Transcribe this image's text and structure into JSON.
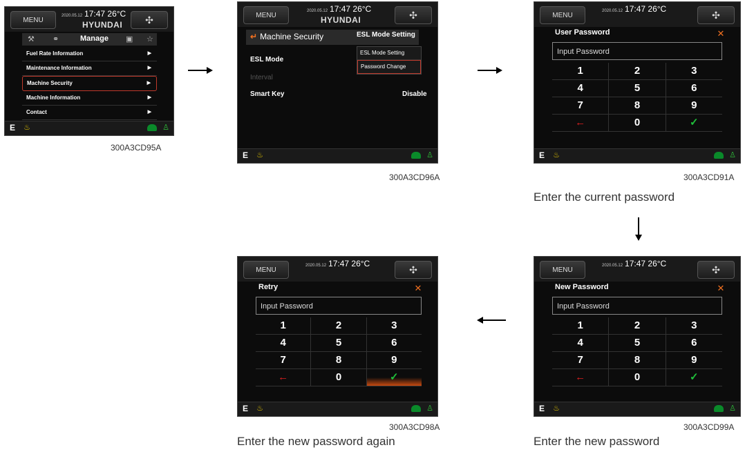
{
  "common": {
    "menu": "MENU",
    "date": "2020.05.12",
    "time": "17:47",
    "temp": "26°C",
    "brand": "HYUNDAI",
    "mode": "E"
  },
  "screen1": {
    "tab_active": "Manage",
    "items": [
      {
        "label": "Fuel Rate Information"
      },
      {
        "label": "Maintenance Information"
      },
      {
        "label": "Machine Security"
      },
      {
        "label": "Machine Information"
      },
      {
        "label": "Contact"
      }
    ],
    "code": "300A3CD95A"
  },
  "screen2": {
    "title": "Machine Security",
    "dropdown": "ESL Mode Setting",
    "dropdown_items": [
      "ESL Mode Setting",
      "Password Change"
    ],
    "rows": [
      {
        "label": "ESL Mode",
        "value": ""
      },
      {
        "label": "Interval",
        "value": ""
      },
      {
        "label": "Smart Key",
        "value": "Disable"
      }
    ],
    "code": "300A3CD96A"
  },
  "screen3": {
    "title": "User Password",
    "placeholder": "Input Password",
    "code": "300A3CD91A",
    "caption": "Enter the current password"
  },
  "screen4": {
    "title": "New Password",
    "placeholder": "Input Password",
    "code": "300A3CD99A",
    "caption": "Enter the new password"
  },
  "screen5": {
    "title": "Retry",
    "placeholder": "Input Password",
    "code": "300A3CD98A",
    "caption": "Enter the new password again"
  },
  "keypad": {
    "rows": [
      [
        "1",
        "2",
        "3"
      ],
      [
        "4",
        "5",
        "6"
      ],
      [
        "7",
        "8",
        "9"
      ],
      [
        "←",
        "0",
        "✓"
      ]
    ]
  }
}
